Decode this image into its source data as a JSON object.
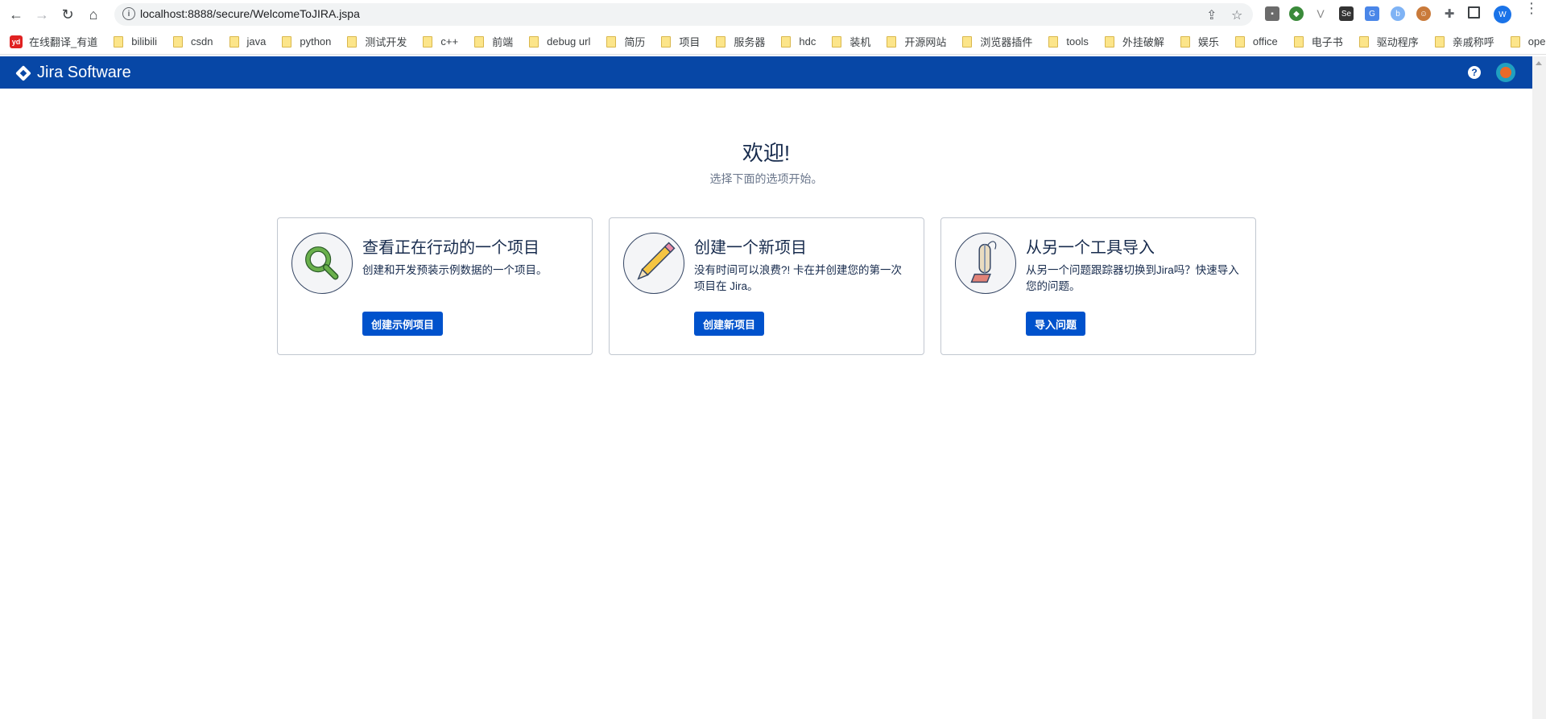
{
  "browser": {
    "url": "localhost:8888/secure/WelcomeToJIRA.jspa",
    "profile_initial": "W",
    "bookmarks": [
      {
        "label": "在线翻译_有道",
        "icon": "youdao-icon"
      },
      {
        "label": "bilibili",
        "icon": "folder-icon"
      },
      {
        "label": "csdn",
        "icon": "folder-icon"
      },
      {
        "label": "java",
        "icon": "folder-icon"
      },
      {
        "label": "python",
        "icon": "folder-icon"
      },
      {
        "label": "测试开发",
        "icon": "folder-icon"
      },
      {
        "label": "c++",
        "icon": "folder-icon"
      },
      {
        "label": "前端",
        "icon": "folder-icon"
      },
      {
        "label": "debug url",
        "icon": "folder-icon"
      },
      {
        "label": "简历",
        "icon": "folder-icon"
      },
      {
        "label": "项目",
        "icon": "folder-icon"
      },
      {
        "label": "服务器",
        "icon": "folder-icon"
      },
      {
        "label": "hdc",
        "icon": "folder-icon"
      },
      {
        "label": "装机",
        "icon": "folder-icon"
      },
      {
        "label": "开源网站",
        "icon": "folder-icon"
      },
      {
        "label": "浏览器插件",
        "icon": "folder-icon"
      },
      {
        "label": "tools",
        "icon": "folder-icon"
      },
      {
        "label": "外挂破解",
        "icon": "folder-icon"
      },
      {
        "label": "娱乐",
        "icon": "folder-icon"
      },
      {
        "label": "office",
        "icon": "folder-icon"
      },
      {
        "label": "电子书",
        "icon": "folder-icon"
      },
      {
        "label": "驱动程序",
        "icon": "folder-icon"
      },
      {
        "label": "亲戚称呼",
        "icon": "folder-icon"
      },
      {
        "label": "openai",
        "icon": "folder-icon"
      }
    ]
  },
  "header": {
    "product_name": "Jira Software",
    "help_symbol": "?"
  },
  "welcome": {
    "title": "欢迎!",
    "subtitle": "选择下面的选项开始。"
  },
  "cards": [
    {
      "title": "查看正在行动的一个项目",
      "description": "创建和开发预装示例数据的一个项目。",
      "button": "创建示例项目",
      "icon": "magnifier-icon"
    },
    {
      "title": "创建一个新项目",
      "description": "没有时间可以浪费?! 卡在并创建您的第一次项目在 Jira。",
      "button": "创建新项目",
      "icon": "pencil-icon"
    },
    {
      "title": "从另一个工具导入",
      "description": "从另一个问题跟踪器切换到Jira吗？快速导入您的问题。",
      "button": "导入问题",
      "icon": "vacuum-icon"
    }
  ]
}
